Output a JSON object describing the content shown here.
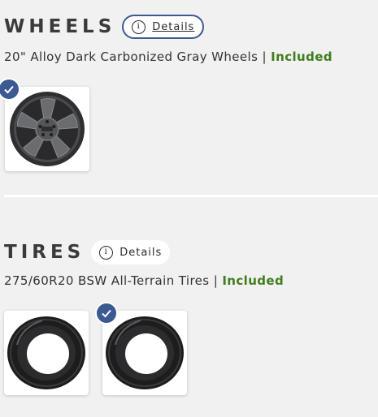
{
  "wheels": {
    "heading": "WHEELS",
    "details_label": "Details",
    "description": "20\" Alloy Dark Carbonized Gray Wheels |",
    "status": "Included",
    "options": [
      {
        "icon": "alloy-wheel-image",
        "selected": true
      }
    ]
  },
  "tires": {
    "heading": "TIRES",
    "details_label": "Details",
    "description": "275/60R20 BSW All-Terrain Tires |",
    "status": "Included",
    "options": [
      {
        "icon": "tire-image",
        "selected": false
      },
      {
        "icon": "tire-image",
        "selected": true
      }
    ]
  },
  "colors": {
    "accent": "#3c5a92",
    "included": "#3f7d1e",
    "background": "#f1f1f1"
  }
}
